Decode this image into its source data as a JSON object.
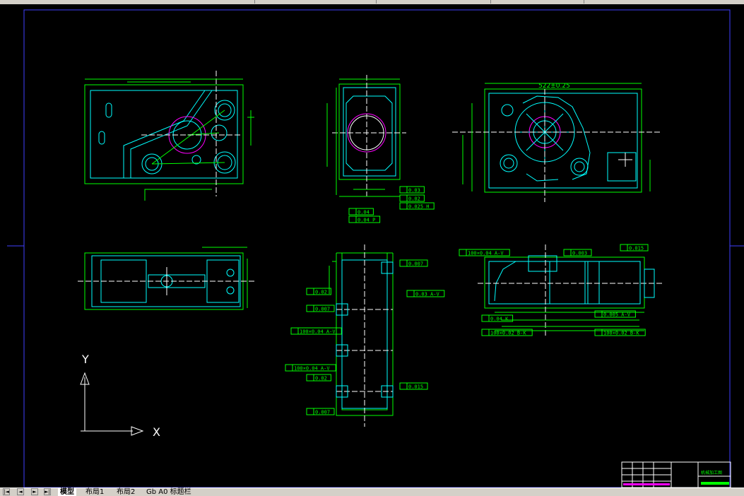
{
  "colors": {
    "background": "#000000",
    "outline": "#00ff00",
    "geometry": "#00ffff",
    "hidden": "#ff00ff",
    "centerline": "#ffffff",
    "dimension": "#00ff00",
    "frame": "#4040ff"
  },
  "top_views": {
    "dim_top_right": "522±0.25"
  },
  "tolerance_callouts": [
    {
      "id": "t1",
      "text": "0.03"
    },
    {
      "id": "t2",
      "text": "0.02"
    },
    {
      "id": "t3",
      "text": "0.025 H"
    },
    {
      "id": "t4",
      "text": "0.04"
    },
    {
      "id": "t5",
      "text": "0.04 P"
    },
    {
      "id": "t6",
      "text": "0.007"
    },
    {
      "id": "t7",
      "text": "0.007"
    },
    {
      "id": "t8",
      "text": "0.007"
    },
    {
      "id": "t9",
      "text": "0.02"
    },
    {
      "id": "t10",
      "text": "100×0.04 A-V"
    },
    {
      "id": "t11",
      "text": "100×0.04 A-V"
    },
    {
      "id": "t12",
      "text": "0.02"
    },
    {
      "id": "t13",
      "text": "0.03 A-V"
    },
    {
      "id": "t14",
      "text": "0.015"
    },
    {
      "id": "t15",
      "text": "100×0.04 A-V"
    },
    {
      "id": "t16",
      "text": "0.003"
    },
    {
      "id": "t17",
      "text": "0.015"
    },
    {
      "id": "t18",
      "text": "0.005 A-V"
    },
    {
      "id": "t19",
      "text": "0.04 K"
    },
    {
      "id": "t20",
      "text": "100×0.02 B-K"
    },
    {
      "id": "t21",
      "text": "100×0.02 B-K"
    }
  ],
  "ucs": {
    "x_label": "X",
    "y_label": "Y"
  },
  "tabs": {
    "nav": [
      "|◄",
      "◄",
      "►",
      "►|"
    ],
    "items": [
      {
        "label": "模型",
        "active": true
      },
      {
        "label": "布局1",
        "active": false
      },
      {
        "label": "布局2",
        "active": false
      },
      {
        "label": "Gb A0 标题栏",
        "active": false
      }
    ]
  },
  "title_block": {
    "title": "机械加工图"
  }
}
